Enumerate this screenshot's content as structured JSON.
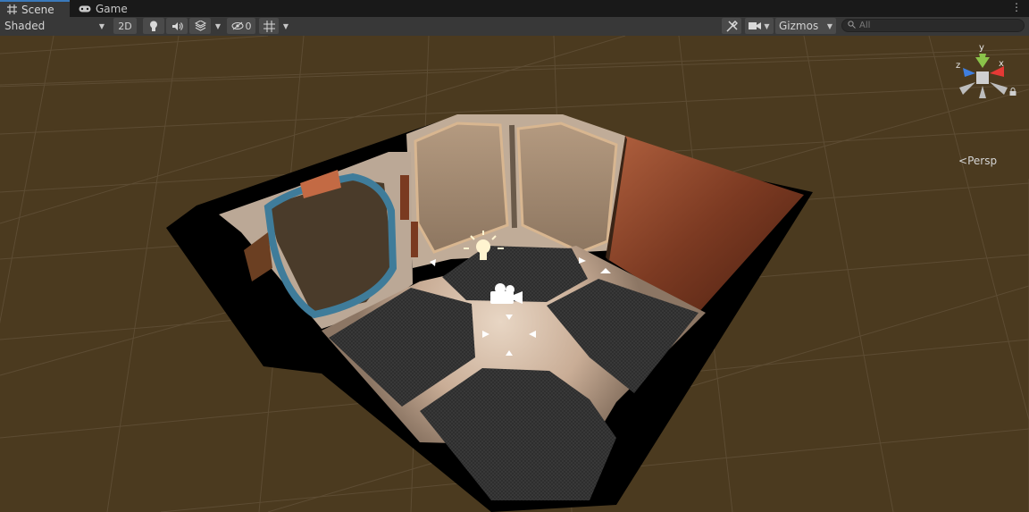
{
  "tabs": [
    {
      "label": "Scene",
      "icon": "grid-icon",
      "active": true
    },
    {
      "label": "Game",
      "icon": "gamepad-icon",
      "active": false
    }
  ],
  "toolbar": {
    "draw_mode": "Shaded",
    "mode_2d_label": "2D",
    "hidden_count": "0",
    "gizmos_label": "Gizmos",
    "search_placeholder": "All"
  },
  "scene": {
    "projection_label": "Persp",
    "axes": [
      "y",
      "x",
      "z"
    ]
  },
  "colors": {
    "tab_accent": "#3a79bb",
    "ground": "#4b3a1f",
    "axis_x": "#e53935",
    "axis_y": "#8bc34a",
    "axis_z": "#3f7fe0"
  }
}
